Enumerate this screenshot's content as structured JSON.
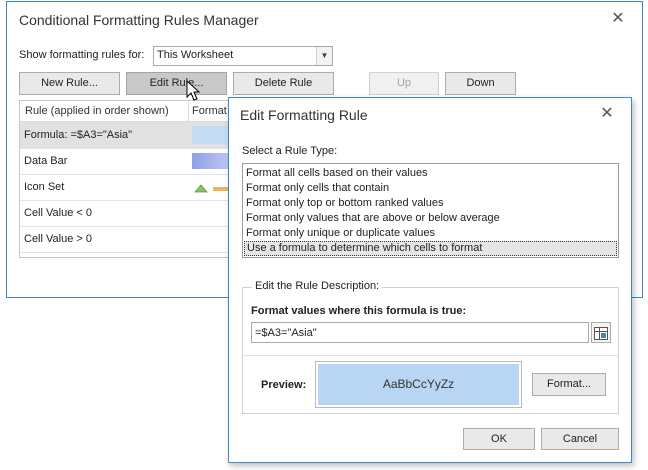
{
  "manager": {
    "title": "Conditional Formatting Rules Manager",
    "show_label": "Show formatting rules for:",
    "scope_value": "This Worksheet",
    "buttons": {
      "new_rule": "New Rule...",
      "edit_rule": "Edit Rule...",
      "delete_rule": "Delete Rule",
      "up": "Up",
      "down": "Down"
    },
    "columns": [
      "Rule (applied in order shown)",
      "Format"
    ],
    "rules": [
      {
        "name": "Formula: =$A3=\"Asia\"",
        "format": "fill",
        "color": "#c6dcf5"
      },
      {
        "name": "Data Bar",
        "format": "databar",
        "color": "#a9b6ef"
      },
      {
        "name": "Icon Set",
        "format": "iconset",
        "color": "#8bc06a"
      },
      {
        "name": "Cell Value < 0",
        "format": "none"
      },
      {
        "name": "Cell Value > 0",
        "format": "none"
      }
    ]
  },
  "edit": {
    "title": "Edit Formatting Rule",
    "select_rule_type_label": "Select a Rule Type:",
    "rule_types": [
      "Format all cells based on their values",
      "Format only cells that contain",
      "Format only top or bottom ranked values",
      "Format only values that are above or below average",
      "Format only unique or duplicate values",
      "Use a formula to determine which cells to format"
    ],
    "selected_index": 5,
    "description_legend": "Edit the Rule Description:",
    "formula_label": "Format values where this formula is true:",
    "formula_value": "=$A3=\"Asia\"",
    "preview_label": "Preview:",
    "preview_text": "AaBbCcYyZz",
    "preview_color": "#b8d5f4",
    "format_button": "Format...",
    "ok": "OK",
    "cancel": "Cancel"
  },
  "colors": {
    "accent": "#3c88c8"
  }
}
